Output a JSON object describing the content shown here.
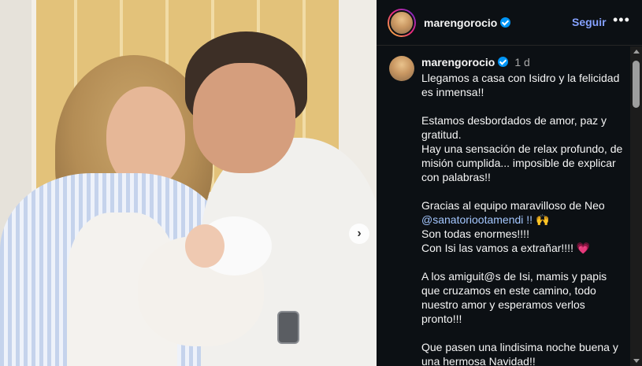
{
  "post": {
    "image_alt": "Foto de familia con recién nacido",
    "next_icon": "chevron-right-icon"
  },
  "header": {
    "username": "marengorocio",
    "verified": true,
    "follow_label": "Seguir",
    "more_label": "•••"
  },
  "caption": {
    "username": "marengorocio",
    "time": "1 d",
    "lines": [
      "Llegamos a casa con Isidro y la felicidad es inmensa!!",
      "",
      "Estamos desbordados de amor, paz y gratitud.",
      "Hay una sensación de relax profundo, de misión cumplida... imposible de explicar con palabras!!",
      "",
      "Gracias al equipo maravilloso de Neo",
      "@sanatoriootamendi !! 🙌",
      "Son todas enormes!!!!",
      "Con Isi las vamos a extrañar!!!! 💗",
      "",
      "A los amiguit@s de Isi, mamis y papis que cruzamos en este camino, todo nuestro amor y esperamos verlos pronto!!!",
      "",
      "Que pasen una lindisima noche buena y una hermosa Navidad!!"
    ]
  },
  "colors": {
    "panel_bg": "#0c1014",
    "follow": "#85a1ff",
    "verified": "#0095f6",
    "mention": "#a4c7ff"
  }
}
